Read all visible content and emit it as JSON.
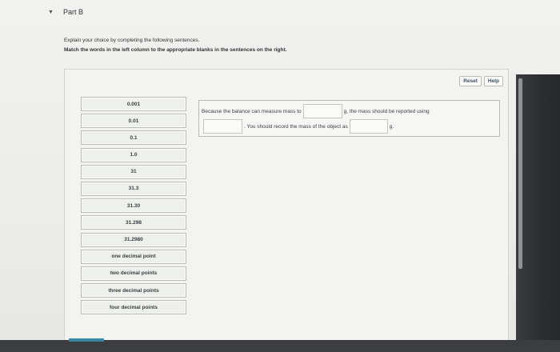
{
  "part": {
    "caret": "▼",
    "title": "Part B"
  },
  "instructions": {
    "line1": "Explain your choice by completing the following sentences.",
    "line2": "Match the words in the left column to the appropriate blanks in the sentences on the right."
  },
  "toolbar": {
    "reset_label": "Reset",
    "help_label": "Help"
  },
  "word_bank": [
    "0.001",
    "0.01",
    "0.1",
    "1.0",
    "31",
    "31.3",
    "31.30",
    "31.298",
    "31.2980",
    "one decimal point",
    "two decimal points",
    "three decimal points",
    "four decimal points"
  ],
  "sentences": {
    "s1_part1": "Because the balance can measure mass to",
    "s1_part2": "g, the mass should be reported using",
    "s2_part1": ". You should record the mass of the object as",
    "s2_part2": "g."
  }
}
